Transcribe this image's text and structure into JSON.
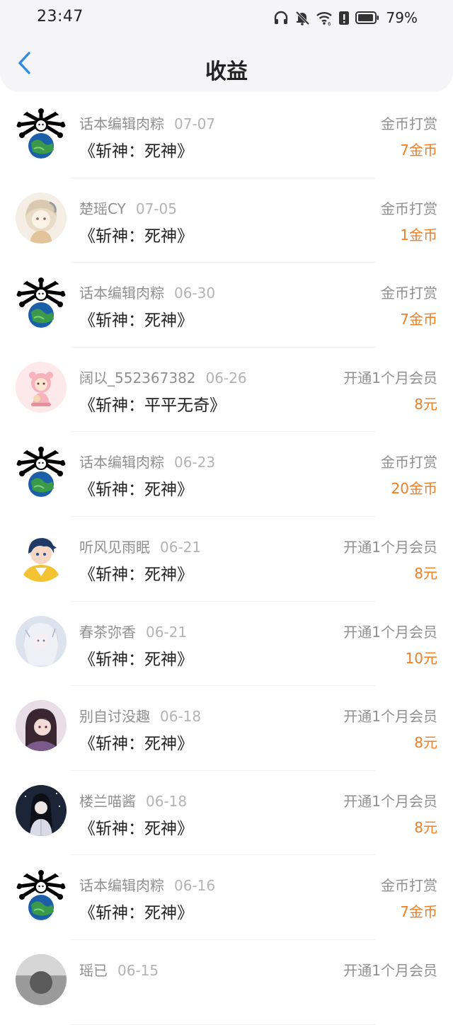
{
  "status_bar": {
    "time": "23:47",
    "battery": "79%",
    "icons": [
      "headphones-icon",
      "mute-bell-icon",
      "wifi-icon",
      "alert-icon",
      "battery-icon"
    ]
  },
  "header": {
    "title": "收益",
    "back_icon": "chevron-left-icon",
    "accent_color": "#2f8ae5"
  },
  "amount_color": "#f07d22",
  "records": [
    {
      "user": "话本编辑肉粽",
      "date": "07-07",
      "work": "《斩神：死神》",
      "type": "金币打赏",
      "amount": "7金币",
      "avatar": "rabbit-globe"
    },
    {
      "user": "楚瑶CY",
      "date": "07-05",
      "work": "《斩神：死神》",
      "type": "金币打赏",
      "amount": "1金币",
      "avatar": "beige-girl"
    },
    {
      "user": "话本编辑肉粽",
      "date": "06-30",
      "work": "《斩神：死神》",
      "type": "金币打赏",
      "amount": "7金币",
      "avatar": "rabbit-globe"
    },
    {
      "user": "阔以_552367382",
      "date": "06-26",
      "work": "《斩神：平平无奇》",
      "type": "开通1个月会员",
      "amount": "8元",
      "avatar": "pink-bear"
    },
    {
      "user": "话本编辑肉粽",
      "date": "06-23",
      "work": "《斩神：死神》",
      "type": "金币打赏",
      "amount": "20金币",
      "avatar": "rabbit-globe"
    },
    {
      "user": "听风见雨眠",
      "date": "06-21",
      "work": "《斩神：死神》",
      "type": "开通1个月会员",
      "amount": "8元",
      "avatar": "yellow-boy"
    },
    {
      "user": "春茶弥香",
      "date": "06-21",
      "work": "《斩神：死神》",
      "type": "开通1个月会员",
      "amount": "10元",
      "avatar": "pale-girl"
    },
    {
      "user": "别自讨没趣",
      "date": "06-18",
      "work": "《斩神：死神》",
      "type": "开通1个月会员",
      "amount": "8元",
      "avatar": "dark-hair"
    },
    {
      "user": "楼兰喵酱",
      "date": "06-18",
      "work": "《斩神：死神》",
      "type": "开通1个月会员",
      "amount": "8元",
      "avatar": "night-girl"
    },
    {
      "user": "话本编辑肉粽",
      "date": "06-16",
      "work": "《斩神：死神》",
      "type": "金币打赏",
      "amount": "7金币",
      "avatar": "rabbit-globe"
    },
    {
      "user": "瑶已",
      "date": "06-15",
      "work": "",
      "type": "开通1个月会员",
      "amount": "",
      "avatar": "gray-photo"
    }
  ]
}
